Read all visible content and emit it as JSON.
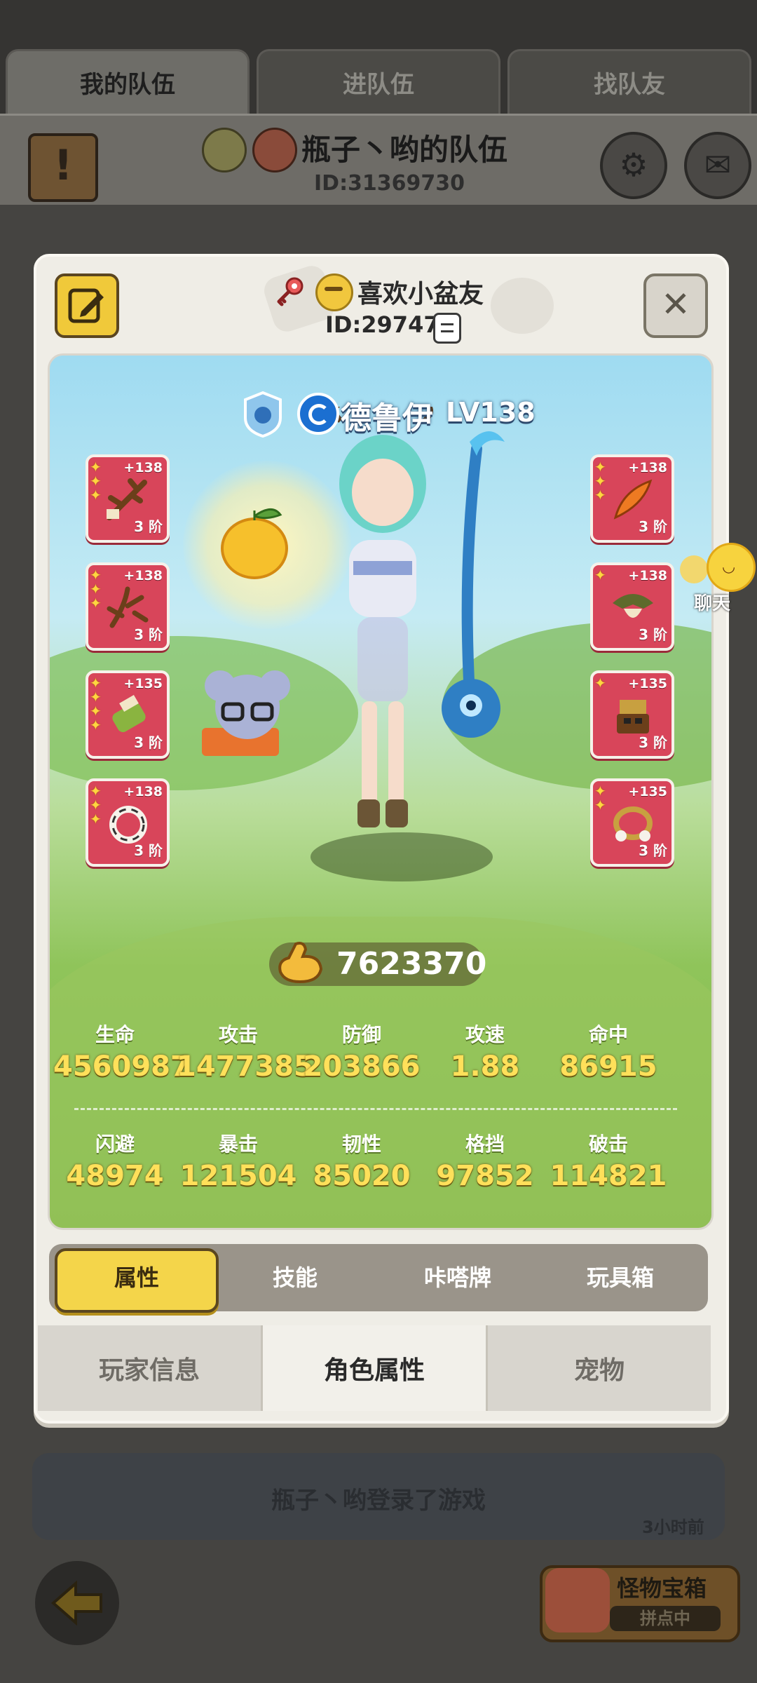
{
  "team_tabs": [
    "我的队伍",
    "进队伍",
    "找队友"
  ],
  "team": {
    "name": "瓶子丶哟的队伍",
    "id": "ID:31369730"
  },
  "log": {
    "player": "瓶子丶哟",
    "action": "登录了游戏",
    "time": "3小时前"
  },
  "chest": {
    "title": "怪物宝箱",
    "status": "拼点中"
  },
  "float_chat": {
    "label": "聊天"
  },
  "profile": {
    "name": "喜欢小盆友",
    "id": "ID:297479"
  },
  "character": {
    "class": "德鲁伊",
    "level": "LV138"
  },
  "equipment_left": [
    {
      "level": "+138",
      "tier": "3 阶",
      "stars": 3,
      "name": "branch-gear-icon"
    },
    {
      "level": "+138",
      "tier": "3 阶",
      "stars": 3,
      "name": "antler-gear-icon"
    },
    {
      "level": "+135",
      "tier": "3 阶",
      "stars": 4,
      "name": "bamboo-gear-icon"
    },
    {
      "level": "+138",
      "tier": "3 阶",
      "stars": 3,
      "name": "ring-gear-icon"
    }
  ],
  "equipment_right": [
    {
      "level": "+138",
      "tier": "3 阶",
      "stars": 3,
      "name": "feather-gear-icon"
    },
    {
      "level": "+138",
      "tier": "3 阶",
      "stars": 1,
      "name": "leaf-hood-gear-icon"
    },
    {
      "level": "+135",
      "tier": "3 阶",
      "stars": 1,
      "name": "totem-gear-icon"
    },
    {
      "level": "+135",
      "tier": "3 阶",
      "stars": 2,
      "name": "bracelet-gear-icon"
    }
  ],
  "power": "7623370",
  "stats_row1": [
    {
      "label": "生命",
      "value": "4560987"
    },
    {
      "label": "攻击",
      "value": "1477385"
    },
    {
      "label": "防御",
      "value": "203866"
    },
    {
      "label": "攻速",
      "value": "1.88"
    },
    {
      "label": "命中",
      "value": "86915"
    }
  ],
  "stats_row2": [
    {
      "label": "闪避",
      "value": "48974"
    },
    {
      "label": "暴击",
      "value": "121504"
    },
    {
      "label": "韧性",
      "value": "85020"
    },
    {
      "label": "格挡",
      "value": "97852"
    },
    {
      "label": "破击",
      "value": "114821"
    }
  ],
  "tabs": [
    "属性",
    "技能",
    "咔嗒牌",
    "玩具箱"
  ],
  "active_tab": 0,
  "bottom_tabs": [
    "玩家信息",
    "角色属性",
    "宠物"
  ],
  "active_bottom_tab": 1,
  "colors": {
    "accent_yellow": "#f4d54a",
    "slot_red": "#d8455a",
    "stat_yellow": "#ffe05a"
  }
}
